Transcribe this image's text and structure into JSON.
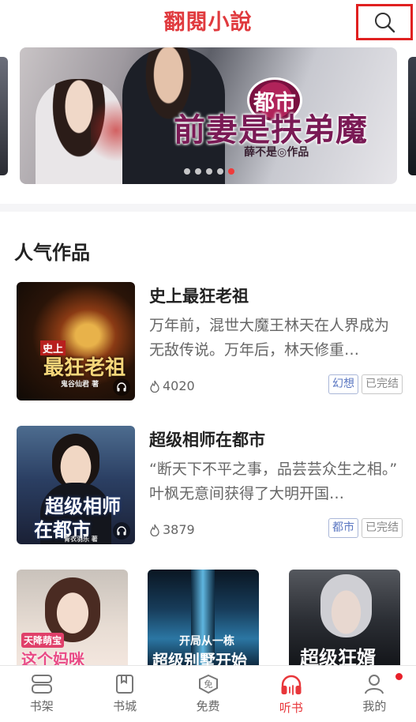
{
  "app": {
    "title": "翻閱小說"
  },
  "header": {
    "search_icon": "search-icon"
  },
  "banner": {
    "genre": "都市",
    "title": "前妻是扶弟魔",
    "author": "薛不是◎作品",
    "dot_count": 5,
    "active_dot": 4
  },
  "section": {
    "title": "人气作品"
  },
  "books": [
    {
      "title": "史上最狂老祖",
      "desc": "万年前，混世大魔王林天在人界成为无敌传说。万年后，林天修重…",
      "popularity": "4020",
      "tags": [
        "幻想",
        "已完结"
      ],
      "cover_text": "最狂老祖",
      "cover_small": "史上",
      "cover_author": "鬼谷仙君 著"
    },
    {
      "title": "超级相师在都市",
      "desc": "“断天下不平之事，品芸芸众生之相。” 叶枫无意间获得了大明开国…",
      "popularity": "3879",
      "tags": [
        "都市",
        "已完结"
      ],
      "cover_text": "超级相师",
      "cover_text2": "在都市",
      "cover_author": "青衣羽乐 著"
    }
  ],
  "grid_covers": [
    {
      "top_text": "天降萌宝",
      "main_text": "这个妈咪"
    },
    {
      "top_text": "开局从一栋",
      "main_text": "超级别墅开始"
    },
    {
      "top_text": "",
      "main_text": "超级狂婿"
    }
  ],
  "nav": [
    {
      "label": "书架",
      "icon": "bookshelf-icon",
      "active": false
    },
    {
      "label": "书城",
      "icon": "bookstore-icon",
      "active": false
    },
    {
      "label": "免费",
      "icon": "free-icon",
      "active": false
    },
    {
      "label": "听书",
      "icon": "headphones-icon",
      "active": true
    },
    {
      "label": "我的",
      "icon": "profile-icon",
      "active": false
    }
  ],
  "colors": {
    "brand": "#e03a3e",
    "active": "#e8363a",
    "tag_blue": "#5c78c2"
  }
}
